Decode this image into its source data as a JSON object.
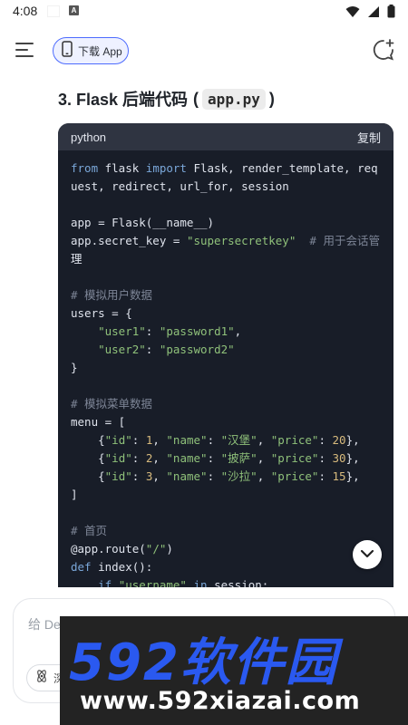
{
  "status_bar": {
    "time": "4:08",
    "notification_icon": "a-square-icon"
  },
  "header": {
    "download_label": "下载 App"
  },
  "section": {
    "number_title": "3. Flask 后端代码",
    "code_name": "app.py"
  },
  "code_block": {
    "language": "python",
    "copy_label": "复制",
    "lines": [
      "from flask import Flask, render_template, req",
      "uest, redirect, url_for, session",
      "",
      "app = Flask(__name__)",
      "app.secret_key = \"supersecretkey\"  # 用于会话管",
      "理",
      "",
      "# 模拟用户数据",
      "users = {",
      "    \"user1\": \"password1\",",
      "    \"user2\": \"password2\"",
      "}",
      "",
      "# 模拟菜单数据",
      "menu = [",
      "    {\"id\": 1, \"name\": \"汉堡\", \"price\": 20},",
      "    {\"id\": 2, \"name\": \"披萨\", \"price\": 30},",
      "    {\"id\": 3, \"name\": \"沙拉\", \"price\": 15},",
      "]",
      "",
      "# 首页",
      "@app.route(\"/\")",
      "def index():",
      "    if \"username\" in session:"
    ]
  },
  "input": {
    "placeholder": "给 De",
    "deep_label": "深"
  },
  "watermark": {
    "title": "592软件园",
    "url": "www.592xiazai.com"
  },
  "colors": {
    "accent": "#4d6bfe",
    "code_bg": "#181d28",
    "watermark_blue": "#2a59f0"
  }
}
